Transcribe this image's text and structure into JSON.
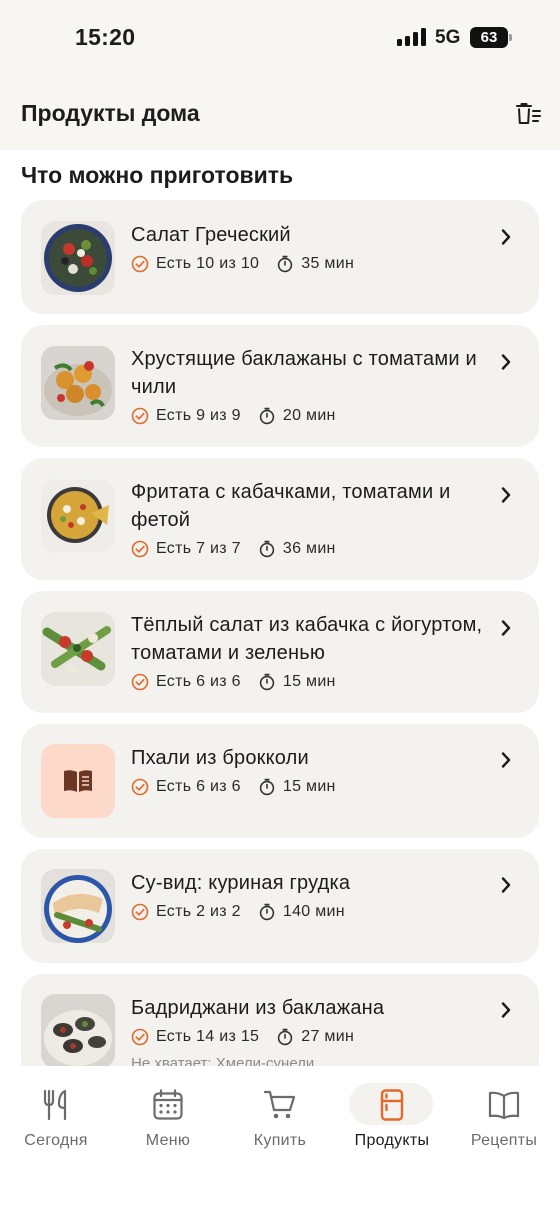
{
  "status_bar": {
    "time": "15:20",
    "network": "5G",
    "battery": "63"
  },
  "header": {
    "title": "Продукты дома",
    "clear_icon": "trash-list-icon"
  },
  "section": {
    "title": "Что можно приготовить"
  },
  "recipes": [
    {
      "name": "Салат Греческий",
      "have": "Есть 10 из 10",
      "time": "35 мин"
    },
    {
      "name": "Хрустящие баклажаны с томатами и чили",
      "have": "Есть 9 из 9",
      "time": "20 мин"
    },
    {
      "name": "Фритата с кабачками, томатами и фетой",
      "have": "Есть 7 из 7",
      "time": "36 мин"
    },
    {
      "name": "Тёплый салат из кабачка с йогуртом, томатами и зеленью",
      "have": "Есть 6 из 6",
      "time": "15 мин"
    },
    {
      "name": "Пхали из брокколи",
      "have": "Есть 6 из 6",
      "time": "15 мин"
    },
    {
      "name": "Су-вид: куриная грудка",
      "have": "Есть 2 из 2",
      "time": "140 мин"
    },
    {
      "name": "Бадриджани из баклажана",
      "have": "Есть 14 из 15",
      "time": "27 мин",
      "missing": "Не хватает: Хмели-сунели"
    }
  ],
  "tabs": [
    {
      "label": "Сегодня",
      "icon": "fork-knife-icon"
    },
    {
      "label": "Меню",
      "icon": "calendar-icon"
    },
    {
      "label": "Купить",
      "icon": "cart-icon"
    },
    {
      "label": "Продукты",
      "icon": "fridge-icon",
      "active": true
    },
    {
      "label": "Рецепты",
      "icon": "book-icon"
    }
  ],
  "colors": {
    "accent": "#e06a2c",
    "card": "#f3f2ef",
    "book_tile": "#fcd9c9"
  }
}
